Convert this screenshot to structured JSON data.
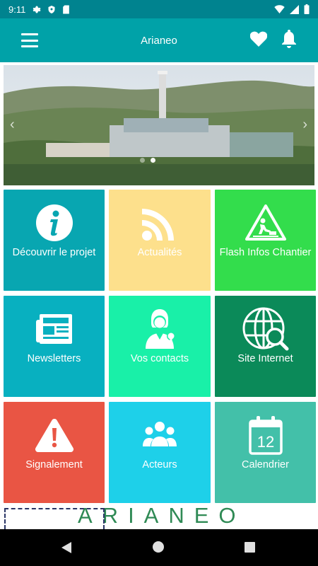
{
  "status_bar": {
    "time": "9:11"
  },
  "app_bar": {
    "title": "Arianeo"
  },
  "carousel": {
    "prev_symbol": "‹",
    "next_symbol": "›",
    "active_index": 1,
    "count": 2
  },
  "tiles": [
    {
      "label": "Découvrir le projet",
      "color": "#08a6b1",
      "icon": "info-icon"
    },
    {
      "label": "Actualités",
      "color": "#fde08c",
      "icon": "rss-icon"
    },
    {
      "label": "Flash Infos Chantier",
      "color": "#33dd4c",
      "icon": "roadwork-warning-icon"
    },
    {
      "label": "Newsletters",
      "color": "#08b0c0",
      "icon": "newspaper-icon"
    },
    {
      "label": "Vos contacts",
      "color": "#19f0a8",
      "icon": "contact-person-icon"
    },
    {
      "label": "Site Internet",
      "color": "#0b8a59",
      "icon": "globe-search-icon"
    },
    {
      "label": "Signalement",
      "color": "#e95544",
      "icon": "alert-triangle-icon"
    },
    {
      "label": "Acteurs",
      "color": "#1ed0e9",
      "icon": "group-icon"
    },
    {
      "label": "Calendrier",
      "color": "#43c0a9",
      "icon": "calendar-icon",
      "day": "12"
    }
  ],
  "logo": {
    "text": "ARIANEO"
  }
}
